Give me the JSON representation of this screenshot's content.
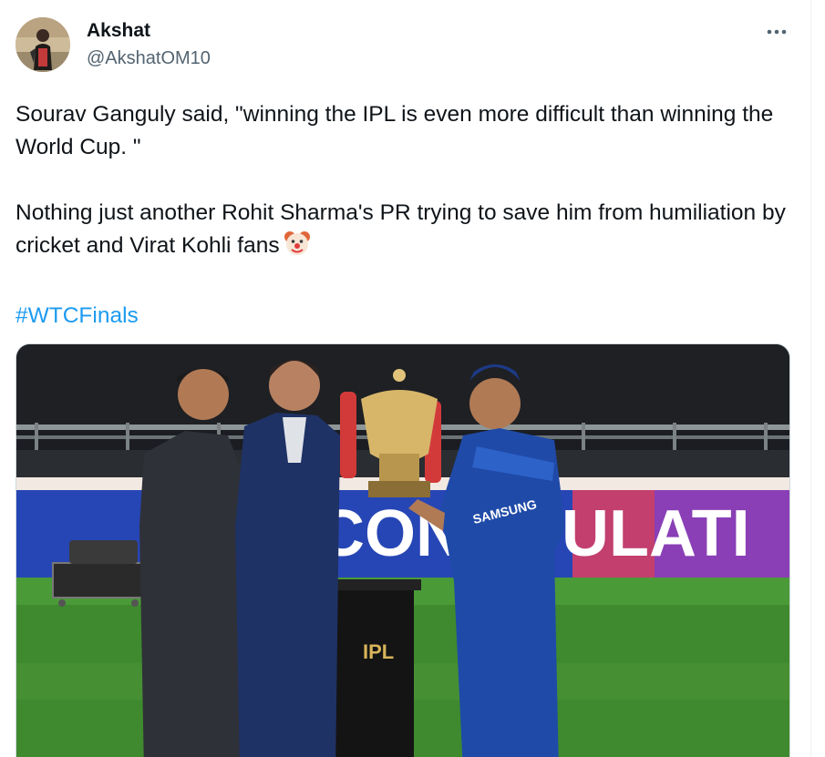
{
  "author": {
    "name": "Akshat",
    "handle": "@AkshatOM10"
  },
  "more_icon": "more-horizontal-icon",
  "tweet": {
    "line1": "Sourav Ganguly said, \"winning the IPL is even more difficult than winning the World Cup. \"",
    "line2": "Nothing just another Rohit Sharma's PR trying to save him from humiliation by cricket and Virat Kohli fans",
    "emoji": "clown-face-icon",
    "hashtag": "#WTCFinals"
  },
  "media": {
    "banner_text": "CON    ATULATI",
    "box_text": "IPL",
    "jersey_text": "SAMSUNG"
  },
  "colors": {
    "link": "#1d9bf0",
    "secondary": "#536471",
    "text": "#0f1419"
  }
}
